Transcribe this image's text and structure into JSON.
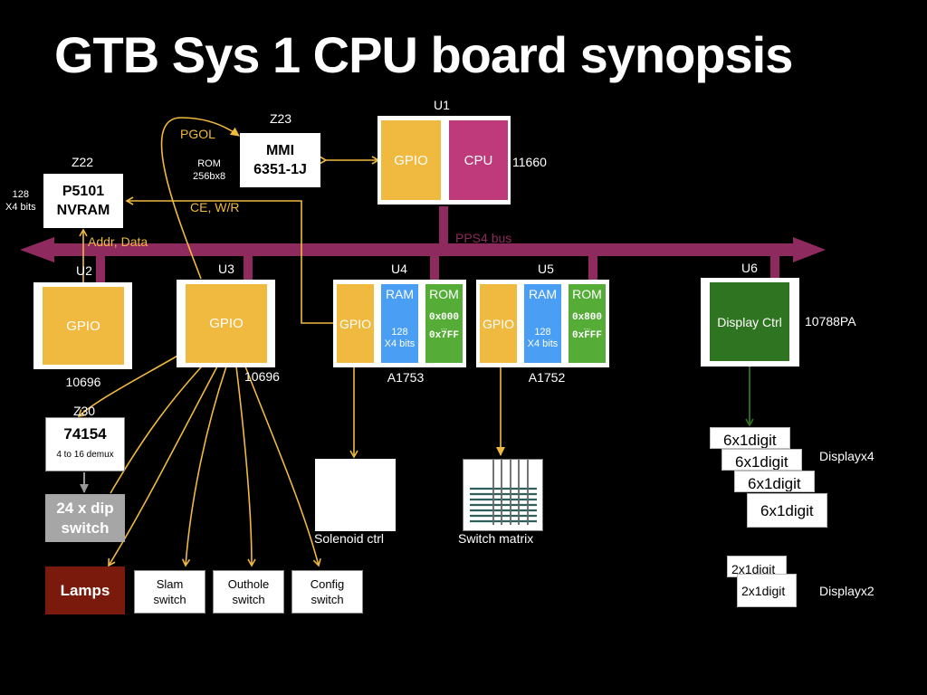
{
  "title": "GTB Sys 1 CPU board synopsis",
  "colors": {
    "background": "#000000",
    "bus": "#8e2a5d",
    "gpio": "#f0b93f",
    "cpu": "#bf3a7a",
    "ram": "#4a9ef3",
    "rom": "#55ad38",
    "display_ctrl": "#2f7420",
    "signal": "#f0b93f",
    "lamps": "#7a1a0c",
    "dip_switch": "#a6a6a6"
  },
  "bus": {
    "label": "PPS4 bus"
  },
  "chips": {
    "u1": {
      "ref": "U1",
      "part": "11660",
      "gpio": "GPIO",
      "cpu": "CPU"
    },
    "z23": {
      "ref": "Z23",
      "line1": "MMI",
      "line2": "6351-1J",
      "note1": "ROM",
      "note2": "256bx8"
    },
    "z22": {
      "ref": "Z22",
      "line1": "P5101",
      "line2": "NVRAM",
      "note1": "128",
      "note2": "X4 bits"
    },
    "u2": {
      "ref": "U2",
      "part": "10696",
      "gpio": "GPIO"
    },
    "u3": {
      "ref": "U3",
      "part": "10696",
      "gpio": "GPIO"
    },
    "u4": {
      "ref": "U4",
      "part": "A1753",
      "gpio": "GPIO",
      "ram": "RAM",
      "ram_size1": "128",
      "ram_size2": "X4 bits",
      "rom": "ROM",
      "rom_start": "0x000",
      "rom_dots": "...",
      "rom_end": "0x7FF"
    },
    "u5": {
      "ref": "U5",
      "part": "A1752",
      "gpio": "GPIO",
      "ram": "RAM",
      "ram_size1": "128",
      "ram_size2": "X4 bits",
      "rom": "ROM",
      "rom_start": "0x800",
      "rom_dots": "...",
      "rom_end": "0xFFF"
    },
    "u6": {
      "ref": "U6",
      "part": "10788PA",
      "ctrl": "Display Ctrl"
    },
    "z30": {
      "ref": "Z30",
      "line1": "74154",
      "line2": "4 to 16 demux"
    }
  },
  "signals": {
    "pgol": "PGOL",
    "ce_wr": "CE, W/R",
    "addr_data": "Addr, Data"
  },
  "peripherals": {
    "dip": {
      "line1": "24 x dip",
      "line2": "switch"
    },
    "lamps": "Lamps",
    "slam": {
      "line1": "Slam",
      "line2": "switch"
    },
    "outhole": {
      "line1": "Outhole",
      "line2": "switch"
    },
    "config": {
      "line1": "Config",
      "line2": "switch"
    },
    "solenoid": "Solenoid ctrl",
    "switch_matrix": "Switch matrix"
  },
  "displays": {
    "six_digit": [
      "6x1digit",
      "6x1digit",
      "6x1digit",
      "6x1digit"
    ],
    "six_label": "Displayx4",
    "two_digit": [
      "2x1digit",
      "2x1digit"
    ],
    "two_label": "Displayx2"
  }
}
